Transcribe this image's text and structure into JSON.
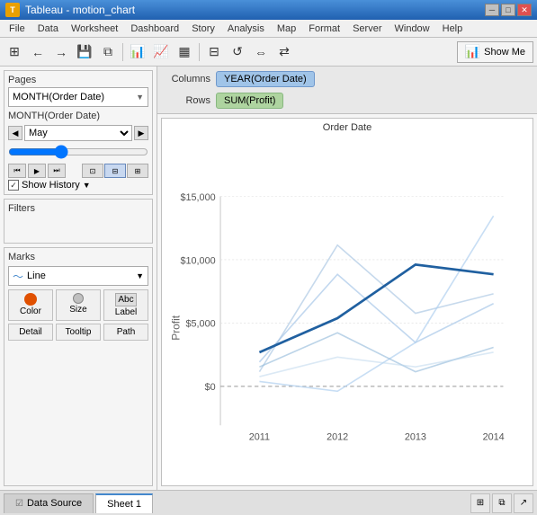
{
  "titleBar": {
    "title": "Tableau - motion_chart",
    "iconLabel": "T",
    "minBtn": "─",
    "maxBtn": "□",
    "closeBtn": "✕"
  },
  "menuBar": {
    "items": [
      "File",
      "Data",
      "Worksheet",
      "Dashboard",
      "Story",
      "Analysis",
      "Map",
      "Format",
      "Server",
      "Window",
      "Help"
    ]
  },
  "toolbar": {
    "showMeLabel": "Show Me"
  },
  "pages": {
    "label": "Pages",
    "dropdown": "MONTH(Order Date)",
    "monthLabel": "MONTH(Order Date)",
    "monthValue": "May",
    "showHistoryLabel": "Show History"
  },
  "filters": {
    "label": "Filters"
  },
  "marks": {
    "label": "Marks",
    "type": "Line",
    "colorLabel": "Color",
    "sizeLabel": "Size",
    "labelLabel": "Label",
    "detailLabel": "Detail",
    "tooltipLabel": "Tooltip",
    "pathLabel": "Path"
  },
  "shelf": {
    "columnsLabel": "Columns",
    "rowsLabel": "Rows",
    "columnsPill": "YEAR(Order Date)",
    "rowsPill": "SUM(Profit)"
  },
  "chart": {
    "title": "Order Date",
    "yAxisLabel": "Profit",
    "xLabels": [
      "2011",
      "2012",
      "2013",
      "2014"
    ],
    "yLabels": [
      "$15,000",
      "$10,000",
      "$5,000",
      "$0"
    ]
  },
  "bottomTabs": {
    "dataSourceLabel": "Data Source",
    "sheet1Label": "Sheet 1"
  }
}
